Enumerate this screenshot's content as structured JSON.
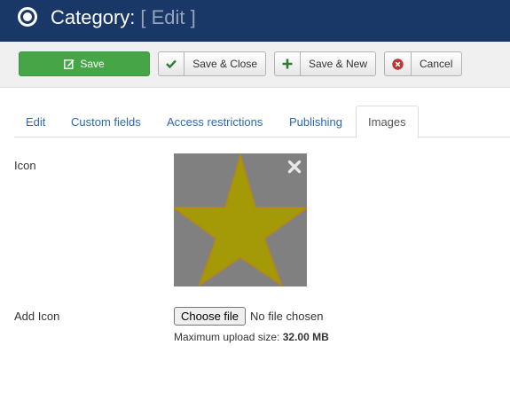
{
  "header": {
    "title": "Category:",
    "mode": "[ Edit ]",
    "icon": "radio-target-icon"
  },
  "toolbar": {
    "save": {
      "label": "Save",
      "icon": "edit-icon"
    },
    "save_close": {
      "label": "Save & Close",
      "icon": "check-icon"
    },
    "save_new": {
      "label": "Save & New",
      "icon": "plus-icon"
    },
    "cancel": {
      "label": "Cancel",
      "icon": "cancel-circle-icon"
    }
  },
  "tabs": [
    {
      "label": "Edit",
      "active": false
    },
    {
      "label": "Custom fields",
      "active": false
    },
    {
      "label": "Access restrictions",
      "active": false
    },
    {
      "label": "Publishing",
      "active": false
    },
    {
      "label": "Images",
      "active": true
    }
  ],
  "fields": {
    "icon_label": "Icon",
    "icon_preview": "star",
    "add_icon_label": "Add Icon",
    "choose_file": "Choose file",
    "no_file": "No file chosen",
    "max_upload_prefix": "Maximum upload size:",
    "max_upload_value": "32.00 MB"
  },
  "colors": {
    "header_bg": "#1a3867",
    "save_green": "#46a546",
    "link_blue": "#2a69b8",
    "star_fill": "#a49a08",
    "preview_bg": "#808080"
  }
}
